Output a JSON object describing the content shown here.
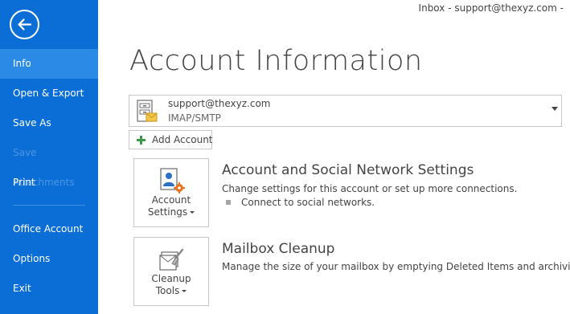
{
  "window": {
    "title": "Inbox - support@thexyz.com -"
  },
  "sidebar": {
    "back_icon": "back-arrow-icon",
    "items": [
      {
        "label": "Info",
        "state": "active"
      },
      {
        "label": "Open & Export",
        "state": "normal"
      },
      {
        "label": "Save As",
        "state": "normal"
      },
      {
        "label": "Save Attachments",
        "state": "disabled"
      },
      {
        "label": "Print",
        "state": "normal"
      },
      {
        "label": "Office Account",
        "state": "normal"
      },
      {
        "label": "Options",
        "state": "normal"
      },
      {
        "label": "Exit",
        "state": "normal"
      }
    ]
  },
  "main": {
    "title": "Account Information",
    "account": {
      "email": "support@thexyz.com",
      "type": "IMAP/SMTP",
      "icon": "account-mail-icon"
    },
    "add_account_label": "Add Account",
    "sections": [
      {
        "button": {
          "line1": "Account",
          "line2": "Settings",
          "icon": "account-settings-icon"
        },
        "title": "Account and Social Network Settings",
        "description": "Change settings for this account or set up more connections.",
        "bullet": "Connect to social networks."
      },
      {
        "button": {
          "line1": "Cleanup",
          "line2": "Tools",
          "icon": "cleanup-tools-icon"
        },
        "title": "Mailbox Cleanup",
        "description": "Manage the size of your mailbox by emptying Deleted Items and archiving."
      }
    ]
  },
  "colors": {
    "sidebar": "#0a6ed6",
    "active_item": "#2a8ae6",
    "disabled_text": "#4d95e2",
    "text": "#444444"
  }
}
